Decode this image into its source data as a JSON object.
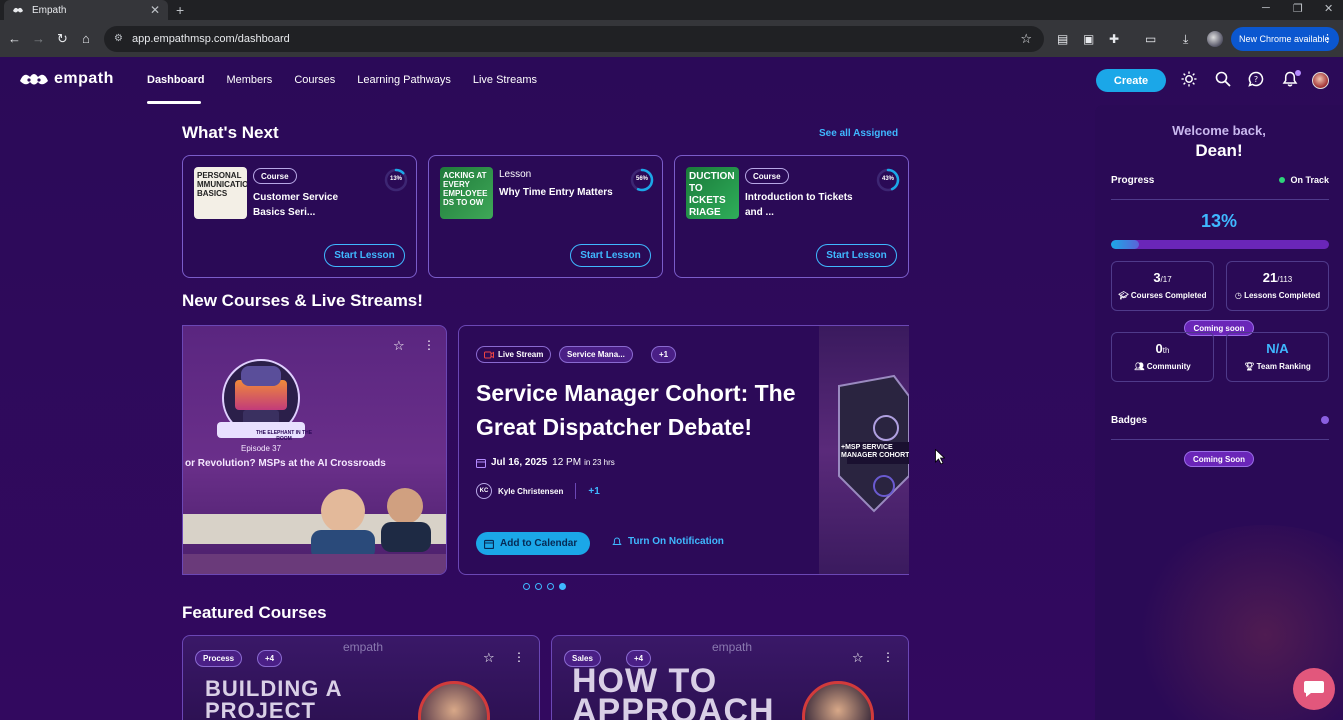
{
  "browser": {
    "tab_title": "Empath",
    "url": "app.empathmsp.com/dashboard",
    "update_label": "New Chrome available"
  },
  "header": {
    "logo_text": "empath",
    "nav": [
      "Dashboard",
      "Members",
      "Courses",
      "Learning Pathways",
      "Live Streams"
    ],
    "create_label": "Create"
  },
  "whats_next": {
    "title": "What's Next",
    "see_all": "See all Assigned",
    "cards": [
      {
        "type": "Course",
        "title": "Customer Service Basics Seri...",
        "progress_label": "13%",
        "progress": 13,
        "button": "Start Lesson",
        "thumb_text": "PERSONAL MMUNICATIO BASICS"
      },
      {
        "type": "Lesson",
        "title": "Why Time Entry Matters",
        "progress_label": "56%",
        "progress": 56,
        "button": "Start Lesson",
        "thumb_text": "ACKING AT EVERY EMPLOYEE DS TO OW"
      },
      {
        "type": "Course",
        "title": "Introduction to Tickets and ...",
        "progress_label": "43%",
        "progress": 43,
        "button": "Start Lesson",
        "thumb_text": "DUCTION TO ICKETS RIAGE"
      }
    ]
  },
  "new_courses": {
    "title": "New Courses & Live Streams!",
    "left_card": {
      "episode": "Episode 37",
      "headline": "or Revolution? MSPs at the AI Crossroads",
      "room_text": "THE ELEPHANT IN THE ROOM"
    },
    "event": {
      "chips": [
        "Live Stream",
        "Service Mana...",
        "+1"
      ],
      "title": "Service Manager Cohort: The Great Dispatcher Debate!",
      "date": "Jul 16, 2025",
      "time": "12 PM",
      "relative": "in 23 hrs",
      "host_initials": "KC",
      "host": "Kyle Christensen",
      "extra_hosts": "+1",
      "add_calendar": "Add to Calendar",
      "notify": "Turn On Notification",
      "art_text": "+MSP SERVICE MANAGER COHORT"
    },
    "slides_total": 4,
    "slide_active": 4
  },
  "featured": {
    "title": "Featured Courses",
    "cards": [
      {
        "tag": "Process",
        "more": "+4",
        "brand": "empath",
        "big_text_1": "BUILDING A",
        "big_text_2": "PROJECT"
      },
      {
        "tag": "Sales",
        "more": "+4",
        "brand": "empath",
        "big_text_1": "HOW TO",
        "big_text_2": "APPROACH"
      }
    ]
  },
  "panel": {
    "welcome": "Welcome back,",
    "name": "Dean!",
    "progress_label": "Progress",
    "status": "On Track",
    "percent": "13%",
    "percent_value": 13,
    "courses_num": "3",
    "courses_total": "/17",
    "courses_label": "Courses Completed",
    "lessons_num": "21",
    "lessons_total": "/113",
    "lessons_label": "Lessons Completed",
    "coming_soon": "Coming soon",
    "community_num": "0",
    "community_suffix": "th",
    "community_label": "Community",
    "ranking_num": "N/A",
    "ranking_label": "Team Ranking",
    "badges_label": "Badges",
    "badges_soon": "Coming Soon"
  },
  "colors": {
    "background": "#2e0a5e",
    "accent": "#1ba7e8",
    "link": "#3fb8ff",
    "card_border": "#7a5cc9",
    "status_green": "#2ed47a",
    "chat_fab": "#e2577c"
  }
}
